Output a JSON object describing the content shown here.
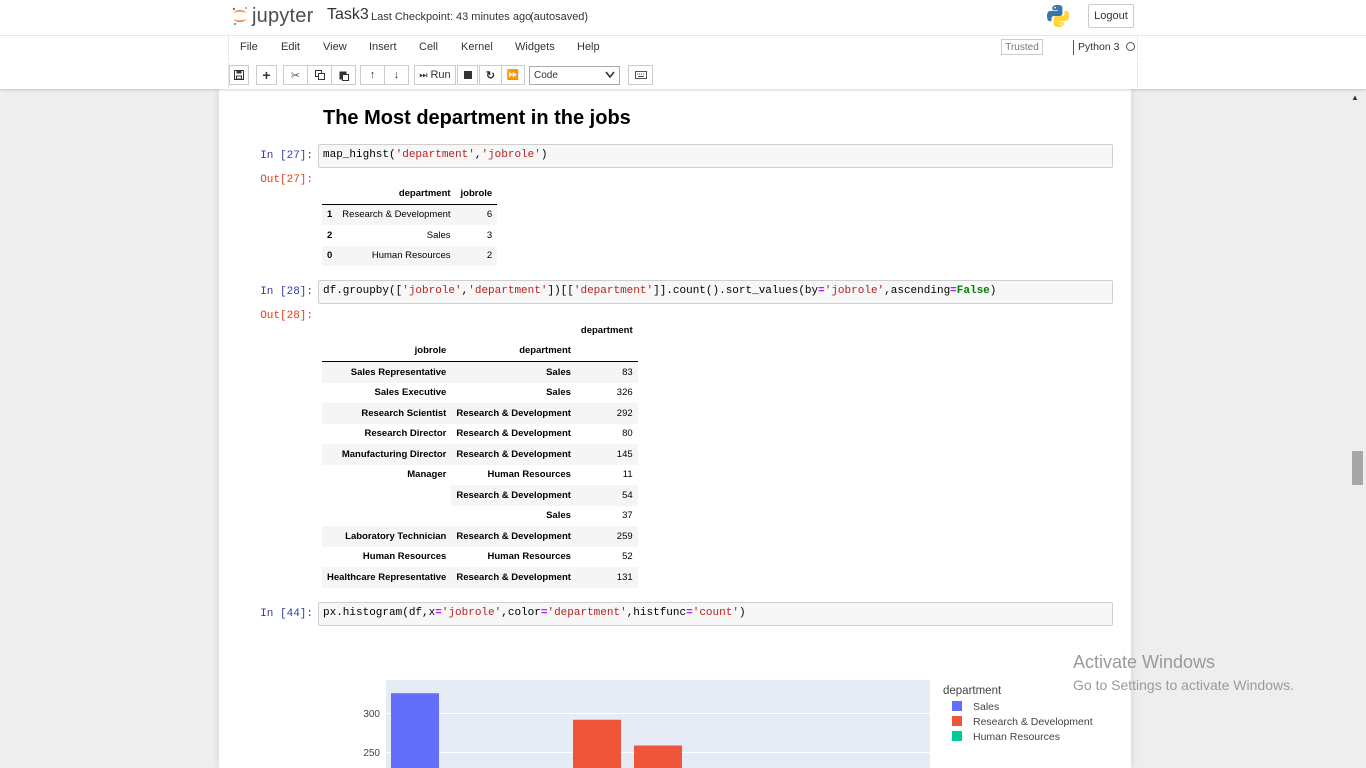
{
  "header": {
    "logo_text": "jupyter",
    "notebook_name": "Task3",
    "checkpoint": "Last Checkpoint: 43 minutes ago",
    "autosave": "(autosaved)",
    "logout_label": "Logout"
  },
  "menu": {
    "items": [
      "File",
      "Edit",
      "View",
      "Insert",
      "Cell",
      "Kernel",
      "Widgets",
      "Help"
    ],
    "trusted": "Trusted",
    "kernel": "Python 3"
  },
  "toolbar": {
    "run_label": "Run",
    "cell_type": "Code",
    "icons": [
      "save-icon",
      "plus-icon",
      "cut-icon",
      "copy-icon",
      "paste-icon",
      "arrow-up-icon",
      "arrow-down-icon",
      "run-icon",
      "stop-icon",
      "restart-icon",
      "fast-forward-icon",
      "keyboard-icon"
    ]
  },
  "notebook": {
    "heading": "The Most department in the jobs",
    "cells": [
      {
        "in_prompt": "In [27]:",
        "code_parts": [
          "map_highst(",
          "'department'",
          ",",
          "'jobrole'",
          ")"
        ],
        "out_prompt": "Out[27]:",
        "table": {
          "columns": [
            "",
            "department",
            "jobrole"
          ],
          "rows": [
            [
              "1",
              "Research & Development",
              "6"
            ],
            [
              "2",
              "Sales",
              "3"
            ],
            [
              "0",
              "Human Resources",
              "2"
            ]
          ]
        }
      },
      {
        "in_prompt": "In [28]:",
        "code_parts": [
          "df.groupby([",
          "'jobrole'",
          ",",
          "'department'",
          "])[[",
          "'department'",
          "]].count().sort_values(by",
          "=",
          "'jobrole'",
          ",ascending",
          "=",
          "False",
          ")"
        ],
        "out_prompt": "Out[28]:",
        "table": {
          "value_column": "department",
          "index_names": [
            "jobrole",
            "department"
          ],
          "rows": [
            [
              "Sales Representative",
              "Sales",
              "83"
            ],
            [
              "Sales Executive",
              "Sales",
              "326"
            ],
            [
              "Research Scientist",
              "Research & Development",
              "292"
            ],
            [
              "Research Director",
              "Research & Development",
              "80"
            ],
            [
              "Manufacturing Director",
              "Research & Development",
              "145"
            ],
            [
              "Manager",
              "Human Resources",
              "11"
            ],
            [
              "",
              "Research & Development",
              "54"
            ],
            [
              "",
              "Sales",
              "37"
            ],
            [
              "Laboratory Technician",
              "Research & Development",
              "259"
            ],
            [
              "Human Resources",
              "Human Resources",
              "52"
            ],
            [
              "Healthcare Representative",
              "Research & Development",
              "131"
            ]
          ]
        }
      },
      {
        "in_prompt": "In [44]:",
        "code_parts": [
          "px.histogram(df,x",
          "=",
          "'jobrole'",
          ",color",
          "=",
          "'department'",
          ",histfunc",
          "=",
          "'count'",
          ")"
        ]
      }
    ]
  },
  "chart_data": {
    "type": "bar",
    "legend_title": "department",
    "legend_position": "top-right",
    "series": [
      {
        "name": "Sales",
        "color": "#636efa"
      },
      {
        "name": "Research & Development",
        "color": "#ef553b"
      },
      {
        "name": "Human Resources",
        "color": "#00cc96"
      }
    ],
    "y_ticks": [
      "300",
      "250"
    ],
    "visible_bars": [
      {
        "series": "Sales",
        "value": 326
      },
      {
        "series": "Research & Development",
        "value": 292
      },
      {
        "series": "Research & Development",
        "value": 259
      }
    ],
    "grid": true,
    "plot_bg": "#e5ecf6"
  },
  "watermark": {
    "line1": "Activate Windows",
    "line2": "Go to Settings to activate Windows."
  }
}
